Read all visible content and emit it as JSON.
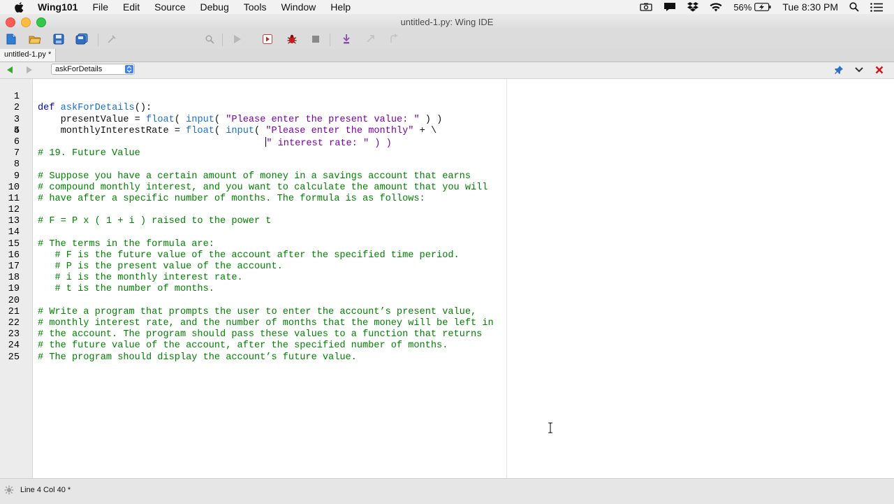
{
  "menubar": {
    "app_name": "Wing101",
    "items": [
      "File",
      "Edit",
      "Source",
      "Debug",
      "Tools",
      "Window",
      "Help"
    ],
    "battery": "56%",
    "clock": "Tue 8:30 PM"
  },
  "window": {
    "title": "untitled-1.py: Wing IDE"
  },
  "toolbar": {
    "search_value": ""
  },
  "tabs": [
    {
      "label": "untitled-1.py *"
    }
  ],
  "scope": {
    "value": "askForDetails"
  },
  "editor": {
    "line_numbers": [
      "1",
      "2",
      "3",
      "4",
      "5",
      "6",
      "7",
      "8",
      "9",
      "10",
      "11",
      "12",
      "13",
      "14",
      "15",
      "16",
      "17",
      "18",
      "19",
      "20",
      "21",
      "22",
      "23",
      "24",
      "25"
    ],
    "lines": [
      "",
      "    presentValue = float( input( \"Please enter the present value: \" ) )",
      "    monthlyInterestRate = float( input( \"Please enter the monthly\" + \\",
      "",
      "",
      "",
      "# 19. Future Value",
      "",
      "# Suppose you have a certain amount of money in a savings account that earns",
      "# compound monthly interest, and you want to calculate the amount that you will",
      "# have after a specific number of months. The formula is as follows:",
      "",
      "# F = P x ( 1 + i ) raised to the power t",
      "",
      "# The terms in the formula are:",
      "   # F is the future value of the account after the specified time period.",
      "   # P is the present value of the account.",
      "   # i is the monthly interest rate.",
      "   # t is the number of months.",
      "",
      "# Write a program that prompts the user to enter the account’s present value,",
      "# monthly interest rate, and the number of months that the money will be left in",
      "# the account. The program should pass these values to a function that returns",
      "# the future value of the account, after the specified number of months.",
      "# The program should display the account’s future value."
    ],
    "line1_kw": "def",
    "line1_fn": "askForDetails",
    "line1_rest": "():",
    "line4_indent": "                                        ",
    "line4_text": "\" interest rate: \" ) )"
  },
  "status": {
    "text": "Line 4 Col 40 *"
  },
  "colors": {
    "keyword": "#0000c8",
    "string": "#7a00a8",
    "comment": "#008000"
  }
}
